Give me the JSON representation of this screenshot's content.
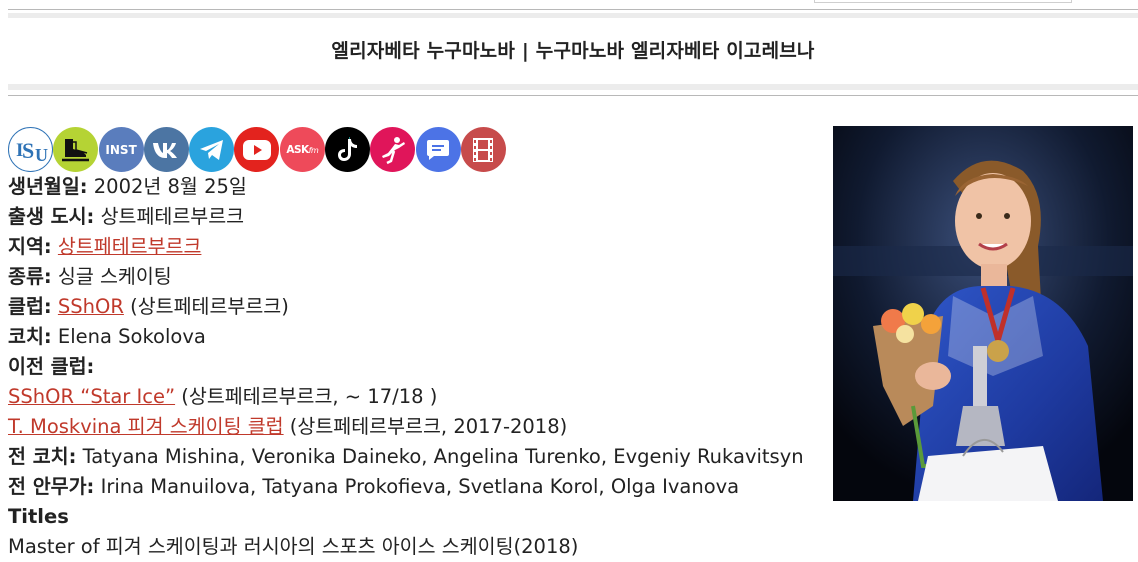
{
  "page": {
    "title": "엘리자베타 누구마노바 | 누구마노바 엘리자베타 이고레브나"
  },
  "social_icons": [
    {
      "name": "isu-icon",
      "label": "ISU",
      "color": "#ffffff"
    },
    {
      "name": "skates-icon",
      "label": "",
      "color": "#b5d334"
    },
    {
      "name": "instagram-icon",
      "label": "INST",
      "color": "#5a7dbd"
    },
    {
      "name": "vk-icon",
      "label": "VK",
      "color": "#4c75a3"
    },
    {
      "name": "telegram-icon",
      "label": "",
      "color": "#2aa3de"
    },
    {
      "name": "youtube-icon",
      "label": "",
      "color": "#e3231e"
    },
    {
      "name": "askfm-icon",
      "label": "ASKfm",
      "color": "#ee4a5a"
    },
    {
      "name": "tiktok-icon",
      "label": "",
      "color": "#000000"
    },
    {
      "name": "skater-icon",
      "label": "",
      "color": "#e0155a"
    },
    {
      "name": "chat-icon",
      "label": "",
      "color": "#4c73e6"
    },
    {
      "name": "film-icon",
      "label": "",
      "color": "#c74b4b"
    }
  ],
  "info": {
    "birth_label": "생년월일:",
    "birth_value": "2002년 8월 25일",
    "city_label": "출생 도시:",
    "city_value": "상트페테르부르크",
    "region_label": "지역:",
    "region_value": "상트페테르부르크",
    "category_label": "종류:",
    "category_value": "싱글 스케이팅",
    "club_label": "클럽:",
    "club_link": "SShOR",
    "club_rest": "(상트페테르부르크)",
    "coach_label": "코치:",
    "coach_value": "Elena Sokolova",
    "prev_clubs_label": "이전 클럽:",
    "prev_club1_link": "SShOR “Star Ice”",
    "prev_club1_rest": "(상트페테르부르크, ~ 17/18 )",
    "prev_club2_link": "T. Moskvina 피겨 스케이팅 클럽",
    "prev_club2_rest": "(상트페테르부르크, 2017-2018)",
    "former_coaches_label": "전 코치:",
    "former_coaches_value": "Tatyana Mishina, Veronika Daineko, Angelina Turenko, Evgeniy Rukavitsyn",
    "former_chor_label": "전 안무가:",
    "former_chor_value": "Irina Manuilova, Tatyana Prokofieva, Svetlana Korol, Olga Ivanova",
    "titles_label": "Titles",
    "titles_value": "Master of 피겨 스케이팅과 러시아의 스포츠 아이스 스케이팅(2018)"
  }
}
